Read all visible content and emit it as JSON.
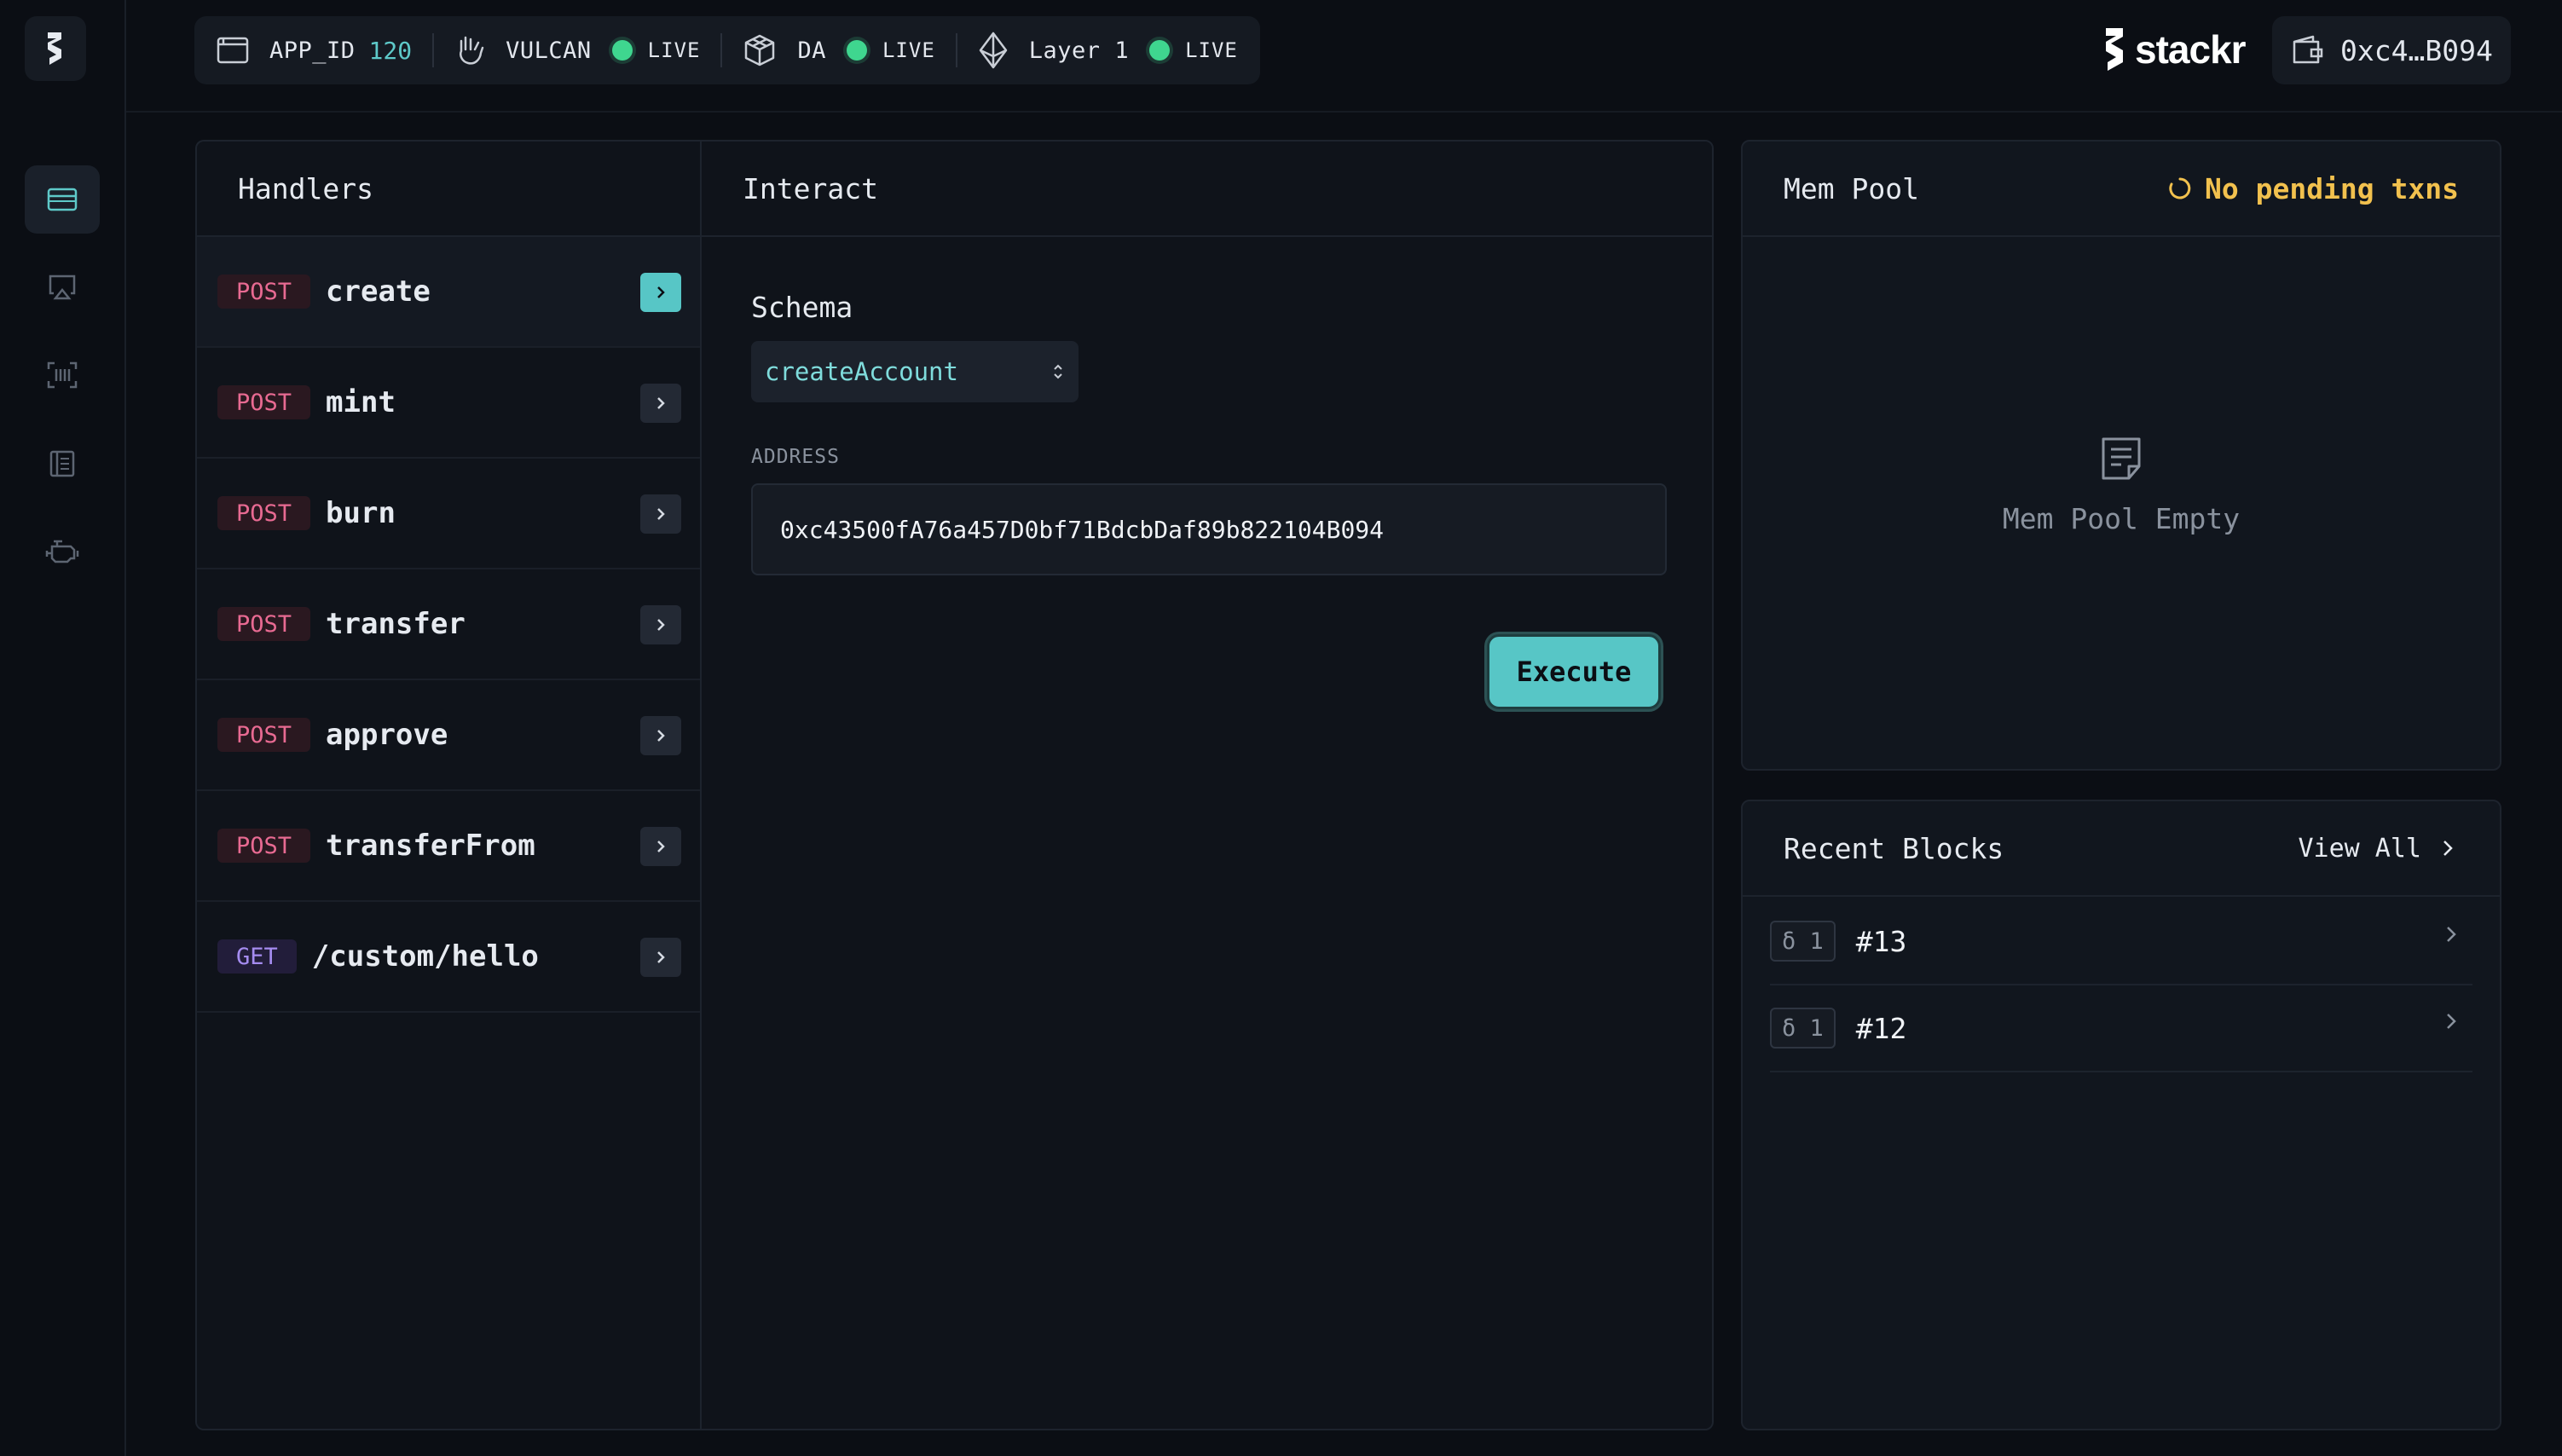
{
  "topbar": {
    "app_id_label": "APP_ID",
    "app_id_value": "120",
    "vulcan_label": "VULCAN",
    "vulcan_status": "LIVE",
    "da_label": "DA",
    "da_status": "LIVE",
    "l1_label": "Layer 1",
    "l1_status": "LIVE",
    "brand": "stackr",
    "wallet_address": "0xc4…B094",
    "live_color": "#3fd68f"
  },
  "sidebar": {
    "items": [
      {
        "icon": "card-icon",
        "active": true
      },
      {
        "icon": "airplay-icon",
        "active": false
      },
      {
        "icon": "barcode-icon",
        "active": false
      },
      {
        "icon": "ledger-icon",
        "active": false
      },
      {
        "icon": "engine-icon",
        "active": false
      }
    ]
  },
  "handlers": {
    "title": "Handlers",
    "items": [
      {
        "method": "POST",
        "name": "create"
      },
      {
        "method": "POST",
        "name": "mint"
      },
      {
        "method": "POST",
        "name": "burn"
      },
      {
        "method": "POST",
        "name": "transfer"
      },
      {
        "method": "POST",
        "name": "approve"
      },
      {
        "method": "POST",
        "name": "transferFrom"
      },
      {
        "method": "GET",
        "name": "/custom/hello"
      }
    ]
  },
  "interact": {
    "title": "Interact",
    "schema_label": "Schema",
    "schema_value": "createAccount",
    "address_label": "ADDRESS",
    "address_value": "0xc43500fA76a457D0bf71BdcbDaf89b822104B094",
    "execute_label": "Execute",
    "accent": "#57c6c6"
  },
  "mempool": {
    "title": "Mem Pool",
    "pending_text": "No pending txns",
    "empty_text": "Mem Pool Empty",
    "pending_color": "#f2c14e"
  },
  "blocks": {
    "title": "Recent Blocks",
    "view_all": "View All",
    "items": [
      {
        "badge": "δ 1",
        "number": "#13"
      },
      {
        "badge": "δ 1",
        "number": "#12"
      }
    ]
  }
}
